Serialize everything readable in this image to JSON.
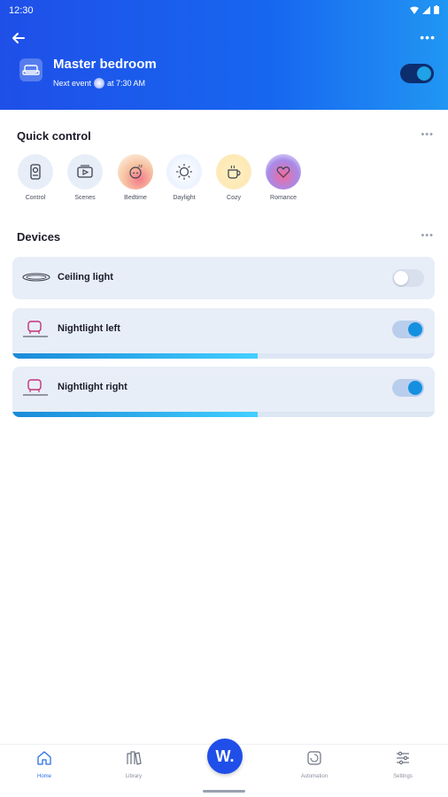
{
  "status": {
    "time": "12:30"
  },
  "header": {
    "title": "Master bedroom",
    "next_event_prefix": "Next event",
    "next_event_time": "at 7:30 AM",
    "toggle_on": true
  },
  "quick_control": {
    "title": "Quick control",
    "items": [
      {
        "label": "Control",
        "icon": "remote-icon"
      },
      {
        "label": "Scenes",
        "icon": "scenes-icon"
      },
      {
        "label": "Bedtime",
        "icon": "bedtime-icon"
      },
      {
        "label": "Daylight",
        "icon": "sun-icon"
      },
      {
        "label": "Cozy",
        "icon": "cup-icon"
      },
      {
        "label": "Romance",
        "icon": "hearts-icon"
      }
    ]
  },
  "devices": {
    "title": "Devices",
    "items": [
      {
        "name": "Ceiling light",
        "on": false,
        "icon": "ceiling-light-icon"
      },
      {
        "name": "Nightlight left",
        "on": true,
        "brightness": 0.58,
        "icon": "nightlight-icon"
      },
      {
        "name": "Nightlight right",
        "on": true,
        "brightness": 0.58,
        "icon": "nightlight-icon"
      }
    ]
  },
  "nav": {
    "home": "Home",
    "library": "Library",
    "fab": "W.",
    "automation": "Automation",
    "settings": "Settings"
  },
  "colors": {
    "accent": "#1f4fe8",
    "toggle_knob_on": "#1590e0"
  }
}
